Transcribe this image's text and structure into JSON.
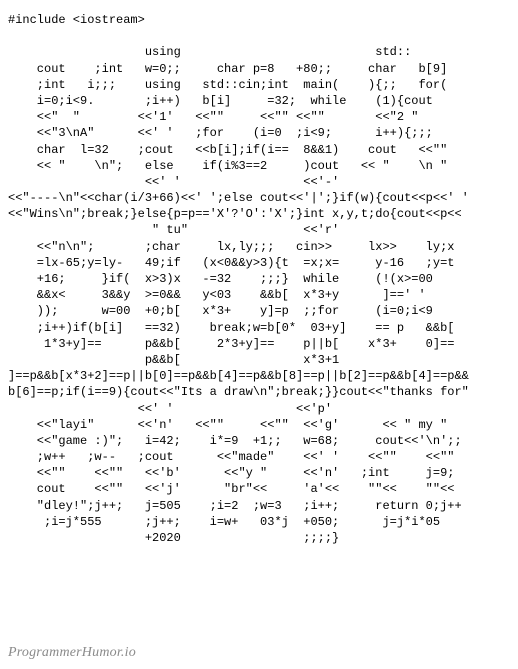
{
  "watermark": "ProgrammerHumor.io",
  "lines": [
    "#include <iostream>",
    "",
    "                   using                           std::",
    "    cout    ;int   w=0;;     char p=8   +80;;     char   b[9]",
    "    ;int   i;;;    using   std::cin;int  main(    ){;;   for(",
    "    i=0;i<9.       ;i++)   b[i]     =32;  while    (1){cout",
    "    <<\"  \"        <<'1'   <<\"\"     <<\"\" <<\"\"       <<\"2 \"",
    "    <<\"3\\nA\"      <<' '   ;for    (i=0  ;i<9;      i++){;;;",
    "    char  l=32    ;cout   <<b[i];if(i==  8&&1)    cout   <<\"\"",
    "    << \"    \\n\";   else    if(i%3==2     )cout   << \"    \\n \"",
    "                   <<' '                 <<'-'",
    "<<\"----\\n\"<<char(i/3+66)<<' ';else cout<<'|';}if(w){cout<<p<<' '",
    "<<\"Wins\\n\";break;}else{p=p=='X'?'O':'X';}int x,y,t;do{cout<<p<<",
    "                    \" tu\"                <<'r'",
    "    <<\"n\\n\";       ;char     lx,ly;;;   cin>>     lx>>    ly;x",
    "    =lx-65;y=ly-   49;if   (x<0&&y>3){t  =x;x=     y-16   ;y=t",
    "    +16;     }if(  x>3)x   -=32    ;;;}  while     (!(x>=00",
    "    &&x<     3&&y  >=0&&   y<03    &&b[  x*3+y      ]==' '",
    "    ));      w=00  +0;b[   x*3+    y]=p  ;;for     (i=0;i<9",
    "    ;i++)if(b[i]   ==32)    break;w=b[0*  03+y]    == p   &&b[",
    "     1*3+y]==      p&&b[     2*3+y]==    p||b[    x*3+    0]==",
    "                   p&&b[                 x*3+1",
    "]==p&&b[x*3+2]==p||b[0]==p&&b[4]==p&&b[8]==p||b[2]==p&&b[4]==p&&",
    "b[6]==p;if(i==9){cout<<\"Its a draw\\n\";break;}}cout<<\"thanks for\"",
    "                  <<' '                 <<'p'",
    "    <<\"layi\"      <<'n'   <<\"\"     <<\"\"  <<'g'      << \" my \"",
    "    <<\"game :)\";   i=42;    i*=9  +1;;   w=68;     cout<<'\\n';;",
    "    ;w++   ;w--   ;cout      <<\"made\"    <<' '    <<\"\"    <<\"\"",
    "    <<\"\"    <<\"\"   <<'b'      <<\"y \"     <<'n'   ;int     j=9;",
    "    cout    <<\"\"   <<'j'      \"br\"<<     'a'<<    \"\"<<    \"\"<<",
    "    \"dley!\";j++;   j=505    ;i=2  ;w=3   ;i++;     return 0;j++",
    "     ;i=j*555      ;j++;    i=w+   03*j  +050;      j=j*i*05",
    "                   +2020                 ;;;;}"
  ]
}
